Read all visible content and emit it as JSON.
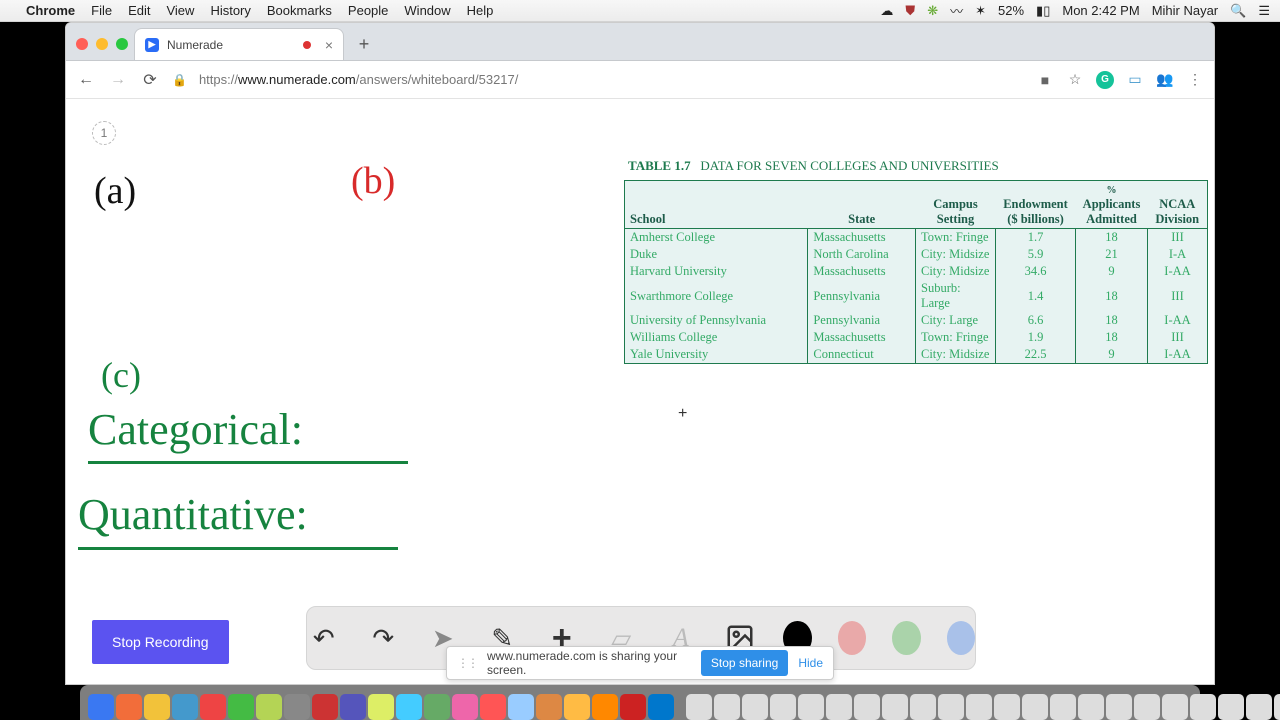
{
  "menubar": {
    "app": "Chrome",
    "items": [
      "File",
      "Edit",
      "View",
      "History",
      "Bookmarks",
      "People",
      "Window",
      "Help"
    ],
    "battery": "52%",
    "clock": "Mon 2:42 PM",
    "user": "Mihir Nayar"
  },
  "tab": {
    "title": "Numerade"
  },
  "url": {
    "scheme": "https://",
    "host": "www.numerade.com",
    "path": "/answers/whiteboard/53217/"
  },
  "whiteboard": {
    "badge": "1",
    "a": "(a)",
    "b": "(b)",
    "c": "(c)",
    "categorical": "Categorical:",
    "quantitative": "Quantitative:",
    "cursor": "+"
  },
  "table": {
    "caption_label": "TABLE 1.7",
    "caption_text": "DATA FOR SEVEN COLLEGES AND UNIVERSITIES",
    "headers": [
      "School",
      "State",
      "Campus Setting",
      "Endowment ($ billions)",
      "% Applicants Admitted",
      "NCAA Division"
    ],
    "rows": [
      [
        "Amherst College",
        "Massachusetts",
        "Town: Fringe",
        "1.7",
        "18",
        "III"
      ],
      [
        "Duke",
        "North Carolina",
        "City: Midsize",
        "5.9",
        "21",
        "I-A"
      ],
      [
        "Harvard University",
        "Massachusetts",
        "City: Midsize",
        "34.6",
        "9",
        "I-AA"
      ],
      [
        "Swarthmore College",
        "Pennsylvania",
        "Suburb: Large",
        "1.4",
        "18",
        "III"
      ],
      [
        "University of Pennsylvania",
        "Pennsylvania",
        "City: Large",
        "6.6",
        "18",
        "I-AA"
      ],
      [
        "Williams College",
        "Massachusetts",
        "Town: Fringe",
        "1.9",
        "18",
        "III"
      ],
      [
        "Yale University",
        "Connecticut",
        "City: Midsize",
        "22.5",
        "9",
        "I-AA"
      ]
    ]
  },
  "buttons": {
    "stop_recording": "Stop Recording"
  },
  "sharebar": {
    "msg": "www.numerade.com is sharing your screen.",
    "stop": "Stop sharing",
    "hide": "Hide"
  }
}
